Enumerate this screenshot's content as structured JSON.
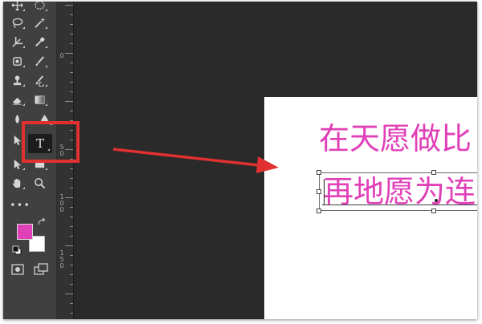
{
  "toolbar": {
    "tools": [
      {
        "icon": "move-icon"
      },
      {
        "icon": "marquee-icon"
      },
      {
        "icon": "lasso-icon"
      },
      {
        "icon": "magic-wand-icon"
      },
      {
        "icon": "crop-icon"
      },
      {
        "icon": "eyedropper-icon"
      },
      {
        "icon": "frame-icon"
      },
      {
        "icon": "brush-icon"
      },
      {
        "icon": "clone-stamp-icon"
      },
      {
        "icon": "history-brush-icon"
      },
      {
        "icon": "eraser-icon"
      },
      {
        "icon": "gradient-icon"
      },
      {
        "icon": "blur-icon"
      },
      {
        "icon": "pen-icon"
      },
      {
        "icon": "path-select-icon"
      },
      {
        "icon": "shape-icon"
      },
      {
        "icon": "hand-icon"
      },
      {
        "icon": "zoom-icon"
      }
    ],
    "type_tool": {
      "icon": "type-tool-icon",
      "glyph": "T"
    },
    "more_tools": "•••",
    "colors": {
      "foreground": "#e040b8",
      "background": "#ffffff"
    }
  },
  "ruler": {
    "labels": [
      "0",
      "50",
      "100",
      "150"
    ]
  },
  "canvas": {
    "line1": "在天愿做比",
    "line2": "再地愿为连",
    "text_color": "#e040b8"
  },
  "annotation": {
    "highlight_color": "#e03030",
    "arrow_color": "#e03030"
  }
}
